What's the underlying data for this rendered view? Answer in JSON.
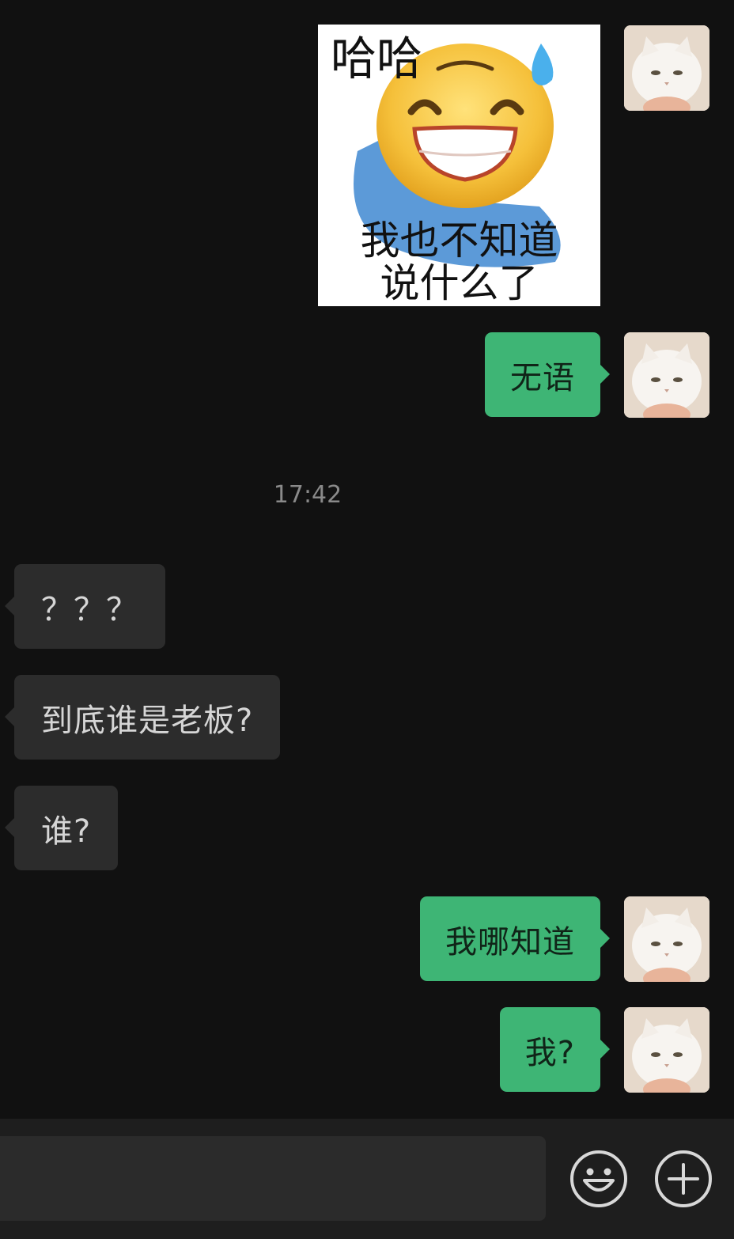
{
  "sticker": {
    "top_text": "哈哈",
    "bottom_line1": "我也不知道",
    "bottom_line2": "说什么了"
  },
  "messages": {
    "m1": "无语",
    "timestamp": "17:42",
    "m2": "？？？",
    "m3": "到底谁是老板?",
    "m4": "谁?",
    "m5": "我哪知道",
    "m6": "我?"
  },
  "input": {
    "placeholder": ""
  },
  "icons": {
    "emoji": "smiley-icon",
    "plus": "plus-circle-icon"
  },
  "colors": {
    "outgoing_bubble": "#3eb575",
    "incoming_bubble": "#2c2c2c",
    "background": "#111111"
  }
}
